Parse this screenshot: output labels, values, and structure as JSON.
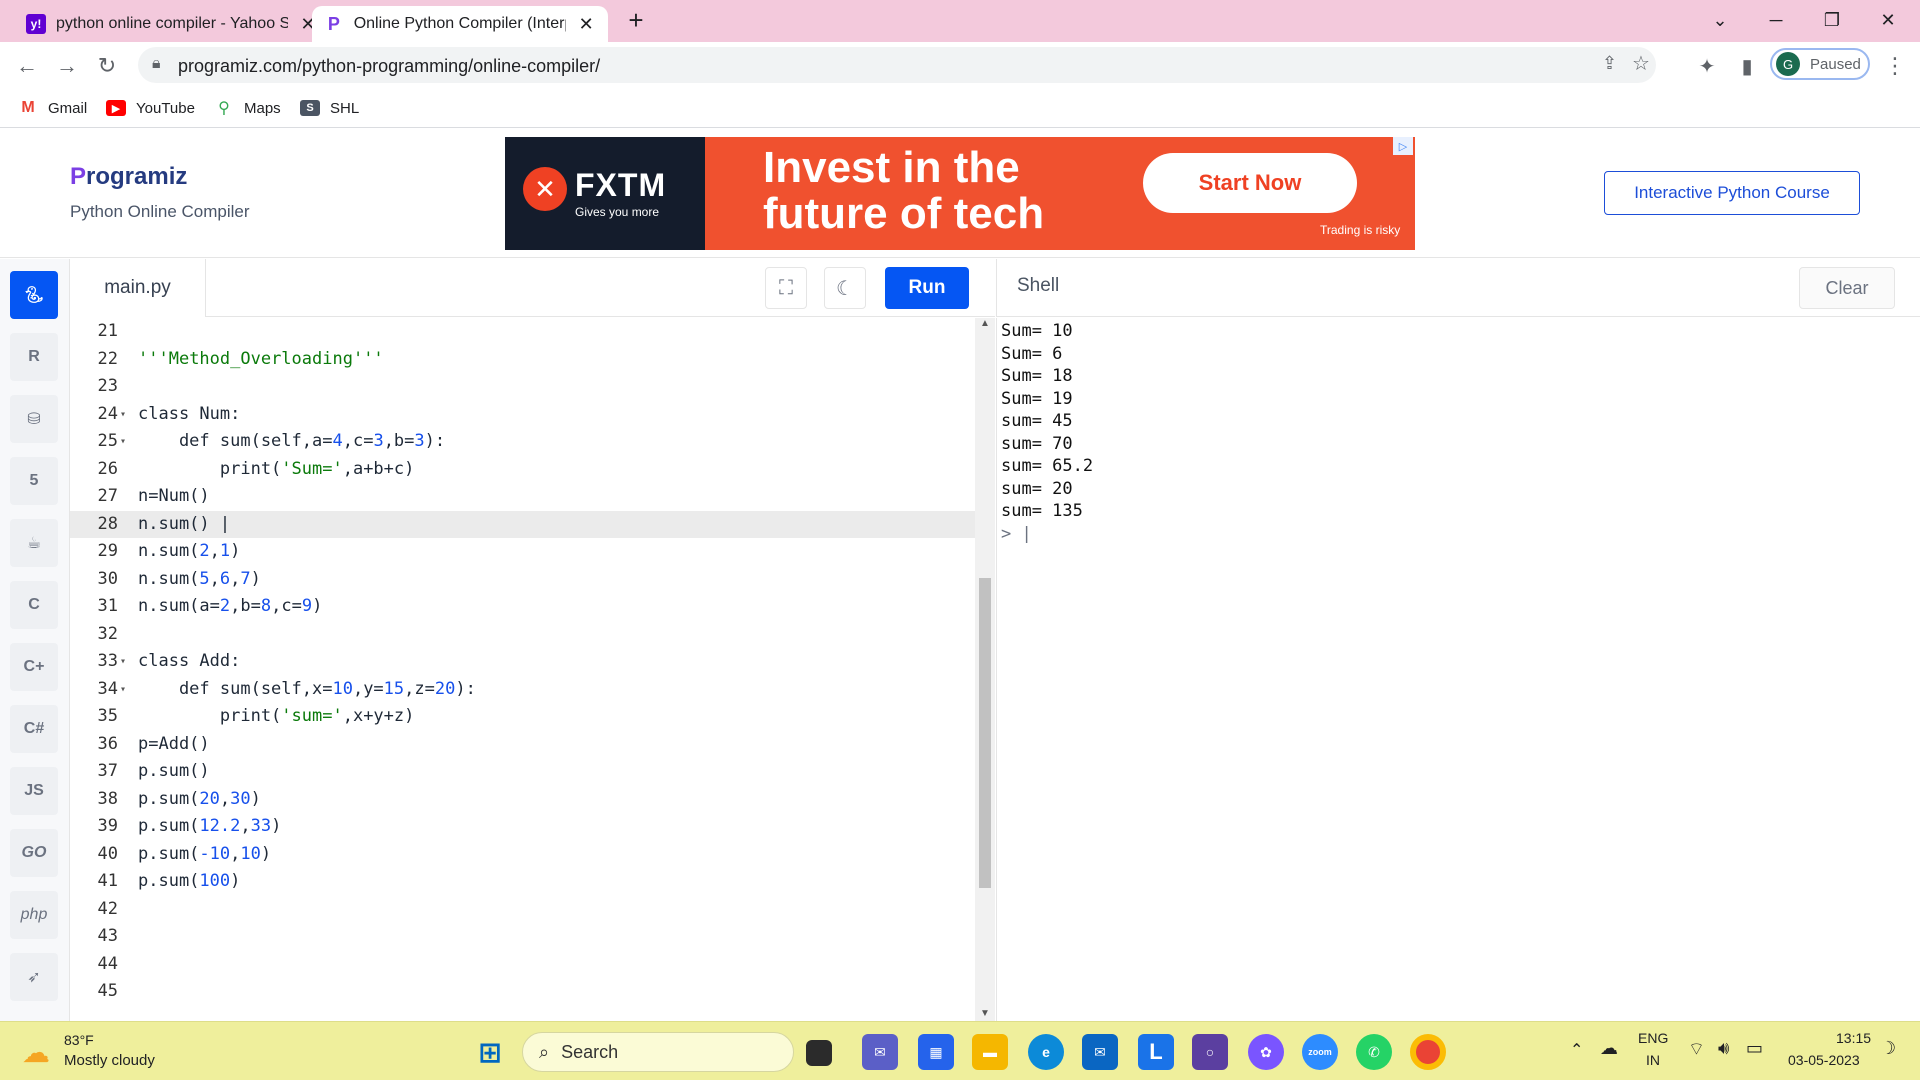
{
  "browser": {
    "tabs": [
      {
        "title": "python online compiler - Yahoo Search",
        "icon": "yahoo-icon"
      },
      {
        "title": "Online Python Compiler (Interpreter)",
        "icon": "programiz-icon"
      }
    ],
    "new_tab": "+",
    "url": "programiz.com/python-programming/online-compiler/",
    "profile_initial": "G",
    "profile_status": "Paused",
    "bookmarks": [
      "Gmail",
      "YouTube",
      "Maps",
      "SHL"
    ]
  },
  "site": {
    "logo_initial": "P",
    "logo_rest": "rogramiz",
    "subtitle": "Python Online Compiler",
    "course_button": "Interactive Python Course",
    "ad": {
      "brand": "FXTM",
      "tagline": "Gives you more",
      "headline": "Invest in the future of tech",
      "cta": "Start Now",
      "disclaimer": "Trading is risky"
    }
  },
  "languages": [
    "python",
    "r",
    "sql",
    "html",
    "java",
    "c",
    "cpp",
    "csharp",
    "JS",
    "GO",
    "php",
    "swift"
  ],
  "editor": {
    "filename": "main.py",
    "run_label": "Run",
    "highlighted_line": 28,
    "lines": [
      {
        "n": "21",
        "fold": "",
        "code": ""
      },
      {
        "n": "22",
        "fold": "",
        "code": "'''Method_Overloading'''"
      },
      {
        "n": "23",
        "fold": "",
        "code": ""
      },
      {
        "n": "24",
        "fold": "▾",
        "code": "class Num:"
      },
      {
        "n": "25",
        "fold": "▾",
        "code": "    def sum(self,a=4,c=3,b=3):"
      },
      {
        "n": "26",
        "fold": "",
        "code": "        print('Sum=',a+b+c)"
      },
      {
        "n": "27",
        "fold": "",
        "code": "n=Num()"
      },
      {
        "n": "28",
        "fold": "",
        "code": "n.sum() |"
      },
      {
        "n": "29",
        "fold": "",
        "code": "n.sum(2,1)"
      },
      {
        "n": "30",
        "fold": "",
        "code": "n.sum(5,6,7)"
      },
      {
        "n": "31",
        "fold": "",
        "code": "n.sum(a=2,b=8,c=9)"
      },
      {
        "n": "32",
        "fold": "",
        "code": ""
      },
      {
        "n": "33",
        "fold": "▾",
        "code": "class Add:"
      },
      {
        "n": "34",
        "fold": "▾",
        "code": "    def sum(self,x=10,y=15,z=20):"
      },
      {
        "n": "35",
        "fold": "",
        "code": "        print('sum=',x+y+z)"
      },
      {
        "n": "36",
        "fold": "",
        "code": "p=Add()"
      },
      {
        "n": "37",
        "fold": "",
        "code": "p.sum()"
      },
      {
        "n": "38",
        "fold": "",
        "code": "p.sum(20,30)"
      },
      {
        "n": "39",
        "fold": "",
        "code": "p.sum(12.2,33)"
      },
      {
        "n": "40",
        "fold": "",
        "code": "p.sum(-10,10)"
      },
      {
        "n": "41",
        "fold": "",
        "code": "p.sum(100)"
      },
      {
        "n": "42",
        "fold": "",
        "code": ""
      },
      {
        "n": "43",
        "fold": "",
        "code": ""
      },
      {
        "n": "44",
        "fold": "",
        "code": ""
      },
      {
        "n": "45",
        "fold": "",
        "code": ""
      }
    ]
  },
  "shell": {
    "title": "Shell",
    "clear_label": "Clear",
    "output": [
      "Sum= 10",
      "Sum= 6",
      "Sum= 18",
      "Sum= 19",
      "sum= 45",
      "sum= 70",
      "sum= 65.2",
      "sum= 20",
      "sum= 135"
    ],
    "prompt": "> |"
  },
  "taskbar": {
    "weather_temp": "83°F",
    "weather_desc": "Mostly cloudy",
    "search_label": "Search",
    "lang_line1": "ENG",
    "lang_line2": "IN",
    "time": "13:15",
    "date": "03-05-2023"
  }
}
